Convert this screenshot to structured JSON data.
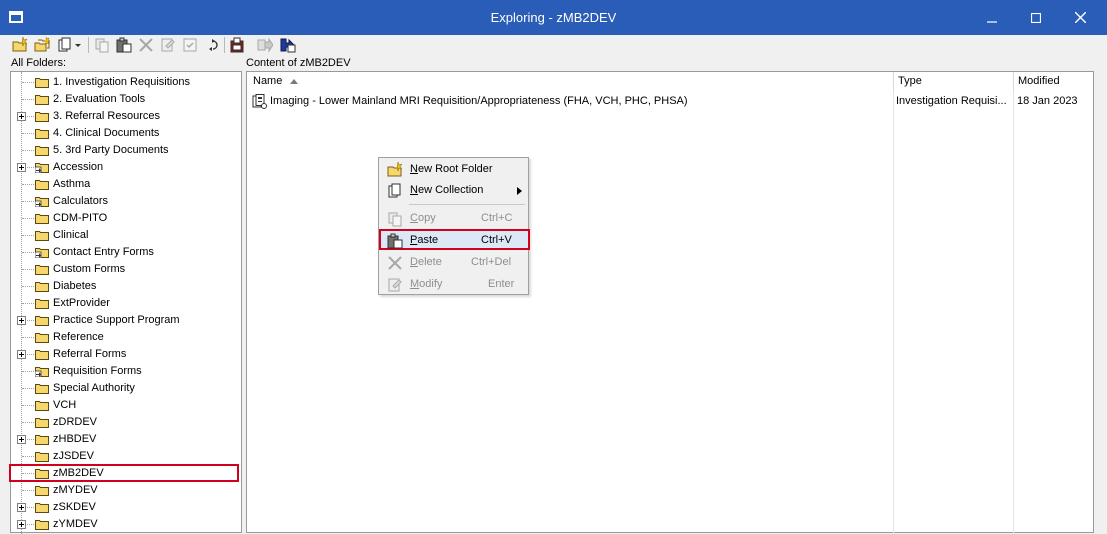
{
  "window": {
    "title": "Exploring - zMB2DEV"
  },
  "left_pane": {
    "label": "All Folders:"
  },
  "right_pane": {
    "label": "Content of zMB2DEV"
  },
  "tree": [
    {
      "label": "1. Investigation Requisitions",
      "icon": "folder-icon",
      "expandable": false
    },
    {
      "label": "2. Evaluation Tools",
      "icon": "folder-icon",
      "expandable": false
    },
    {
      "label": "3. Referral Resources",
      "icon": "folder-icon",
      "expandable": true
    },
    {
      "label": "4. Clinical Documents",
      "icon": "folder-icon",
      "expandable": false
    },
    {
      "label": "5. 3rd Party Documents",
      "icon": "folder-icon",
      "expandable": false
    },
    {
      "label": "Accession",
      "icon": "shared-folder-icon",
      "expandable": true
    },
    {
      "label": "Asthma",
      "icon": "folder-icon",
      "expandable": false
    },
    {
      "label": "Calculators",
      "icon": "shared-folder-icon",
      "expandable": false
    },
    {
      "label": "CDM-PITO",
      "icon": "folder-icon",
      "expandable": false
    },
    {
      "label": "Clinical",
      "icon": "folder-icon",
      "expandable": false
    },
    {
      "label": "Contact Entry Forms",
      "icon": "shared-folder-icon",
      "expandable": false
    },
    {
      "label": "Custom Forms",
      "icon": "folder-icon",
      "expandable": false
    },
    {
      "label": "Diabetes",
      "icon": "folder-icon",
      "expandable": false
    },
    {
      "label": "ExtProvider",
      "icon": "folder-icon",
      "expandable": false
    },
    {
      "label": "Practice Support Program",
      "icon": "folder-icon",
      "expandable": true
    },
    {
      "label": "Reference",
      "icon": "folder-icon",
      "expandable": false
    },
    {
      "label": "Referral Forms",
      "icon": "folder-icon",
      "expandable": true
    },
    {
      "label": "Requisition Forms",
      "icon": "shared-folder-icon",
      "expandable": false
    },
    {
      "label": "Special Authority",
      "icon": "folder-icon",
      "expandable": false
    },
    {
      "label": "VCH",
      "icon": "folder-icon",
      "expandable": false
    },
    {
      "label": "zDRDEV",
      "icon": "folder-icon",
      "expandable": false
    },
    {
      "label": "zHBDEV",
      "icon": "folder-icon",
      "expandable": true
    },
    {
      "label": "zJSDEV",
      "icon": "folder-icon",
      "expandable": false
    },
    {
      "label": "zMB2DEV",
      "icon": "folder-icon",
      "expandable": false,
      "selected": true
    },
    {
      "label": "zMYDEV",
      "icon": "folder-icon",
      "expandable": false
    },
    {
      "label": "zSKDEV",
      "icon": "folder-icon",
      "expandable": true
    },
    {
      "label": "zYMDEV",
      "icon": "folder-icon",
      "expandable": true
    }
  ],
  "columns": {
    "name": "Name",
    "type": "Type",
    "modified": "Modified"
  },
  "files": [
    {
      "name": "Imaging - Lower Mainland MRI Requisition/Appropriateness (FHA, VCH, PHC, PHSA)",
      "type": "Investigation Requisi...",
      "modified": "18 Jan 2023"
    }
  ],
  "context_menu": {
    "items": [
      {
        "label": "New Root Folder",
        "shortcut": "",
        "enabled": true
      },
      {
        "label": "New Collection",
        "shortcut": "",
        "enabled": true,
        "submenu": true
      },
      {
        "label": "Copy",
        "shortcut": "Ctrl+C",
        "enabled": false
      },
      {
        "label": "Paste",
        "shortcut": "Ctrl+V",
        "enabled": true,
        "highlighted": true
      },
      {
        "label": "Delete",
        "shortcut": "Ctrl+Del",
        "enabled": false
      },
      {
        "label": "Modify",
        "shortcut": "Enter",
        "enabled": false
      }
    ]
  },
  "colors": {
    "titlebar": "#2a5db8",
    "highlight_outline": "#d0021b",
    "folder": "#f5d76e"
  }
}
